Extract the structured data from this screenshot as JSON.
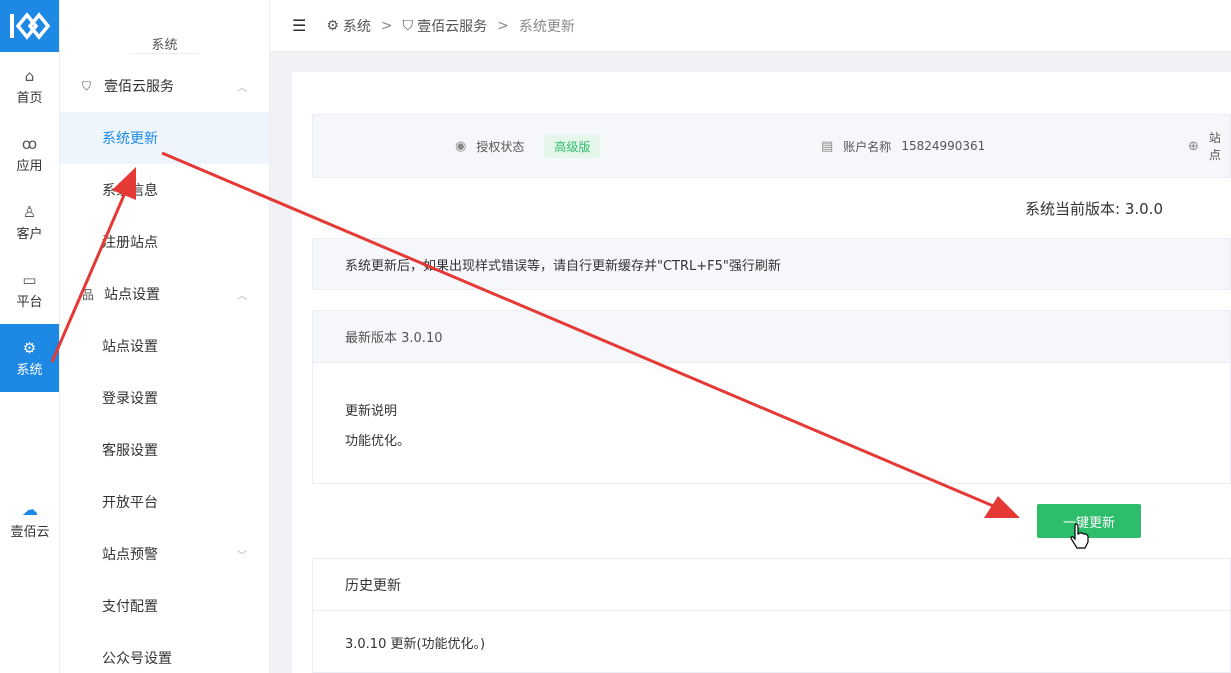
{
  "rail": {
    "items": [
      {
        "label": "首页",
        "icon": "home-icon",
        "glyph": "⌂"
      },
      {
        "label": "应用",
        "icon": "apps-icon",
        "glyph": "ꝏ"
      },
      {
        "label": "客户",
        "icon": "user-icon",
        "glyph": "♙"
      },
      {
        "label": "平台",
        "icon": "monitor-icon",
        "glyph": "▭"
      },
      {
        "label": "系统",
        "icon": "gear-icon",
        "glyph": "⚙"
      }
    ],
    "active_index": 4,
    "cloud": {
      "label": "壹佰云",
      "icon": "cloud-icon",
      "glyph": "☁"
    }
  },
  "menu": {
    "title": "系统",
    "groups": [
      {
        "label": "壹佰云服务",
        "icon": "shield-icon",
        "glyph": "⛉",
        "expanded": true,
        "items": [
          "系统更新",
          "系统信息",
          "注册站点"
        ]
      },
      {
        "label": "站点设置",
        "icon": "sitemap-icon",
        "glyph": "品",
        "expanded": true,
        "items": [
          "站点设置",
          "登录设置",
          "客服设置",
          "开放平台",
          "站点预警",
          "支付配置",
          "公众号设置"
        ]
      }
    ],
    "active_item": "系统更新"
  },
  "breadcrumb": {
    "items": [
      "系统",
      "壹佰云服务",
      "系统更新"
    ],
    "separator": ">"
  },
  "status": {
    "auth_label": "授权状态",
    "auth_badge": "高级版",
    "account_label": "账户名称",
    "account_value": "15824990361",
    "site_label": "站点"
  },
  "current_version": "系统当前版本: 3.0.0",
  "notice": "系统更新后，如果出现样式错误等，请自行更新缓存并\"CTRL+F5\"强行刷新",
  "latest": {
    "title": "最新版本 3.0.10",
    "notes_title": "更新说明",
    "notes": "功能优化。"
  },
  "update_button": "一键更新",
  "history": {
    "title": "历史更新",
    "rows": [
      "3.0.10 更新(功能优化。)"
    ]
  },
  "colors": {
    "primary": "#1e88e5",
    "success": "#2ebd6b",
    "annotation": "#e53935"
  }
}
